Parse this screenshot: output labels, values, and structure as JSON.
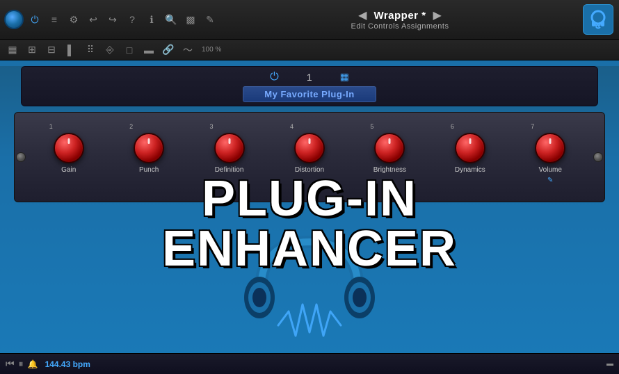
{
  "header": {
    "wrapper_title": "Wrapper *",
    "wrapper_subtitle": "Edit Controls Assignments",
    "nav_left": "◀",
    "nav_right": "▶",
    "percent": "100 %"
  },
  "plugin_header": {
    "preset_name": "My Favorite Plug-In",
    "preset_number": "1"
  },
  "knobs": [
    {
      "number": "1",
      "label": "Gain"
    },
    {
      "number": "2",
      "label": "Punch"
    },
    {
      "number": "3",
      "label": "Definition"
    },
    {
      "number": "4",
      "label": "Distortion"
    },
    {
      "number": "5",
      "label": "Brightness"
    },
    {
      "number": "6",
      "label": "Dynamics"
    },
    {
      "number": "7",
      "label": "Volume"
    }
  ],
  "overlay": {
    "line1": "PLUG-IN",
    "line2": "ENHANCER"
  },
  "transport": {
    "bpm": "144.43 bpm"
  },
  "toolbar_icons": {
    "power": "⏻",
    "menu": "≡",
    "gear": "⚙",
    "undo": "↩",
    "redo": "↪",
    "question": "?",
    "info": "ℹ",
    "search": "🔍",
    "chart": "📊",
    "edit": "✎",
    "grid1": "⊞",
    "grid2": "⊟",
    "bar": "▌",
    "dots": "⠿",
    "square": "□",
    "link": "🔗",
    "wave": "〜"
  }
}
